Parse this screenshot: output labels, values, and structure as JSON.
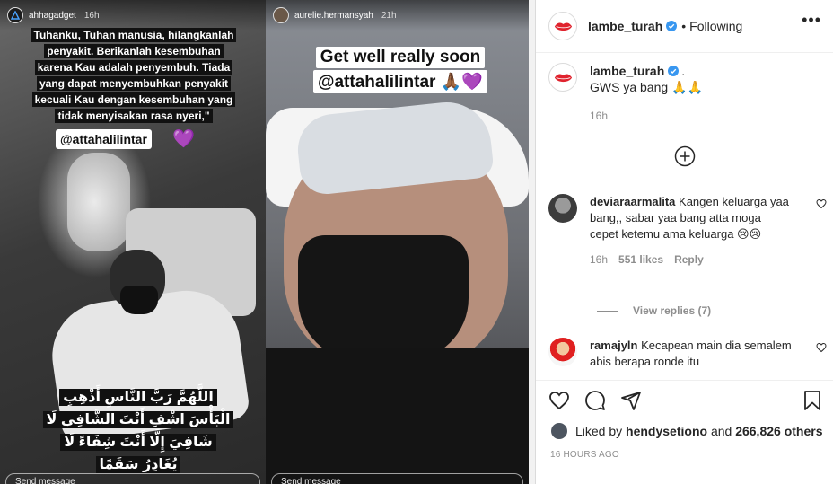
{
  "story_left": {
    "username": "ahhagadget",
    "time": "16h",
    "quote_lines": [
      "Tuhanku, Tuhan manusia, hilangkanlah",
      "penyakit. Berikanlah kesembuhan",
      "karena Kau adalah penyembuh. Tiada",
      "yang dapat menyembuhkan penyakit",
      "kecuali Kau dengan kesembuhan yang",
      "tidak menyisakan rasa nyeri,\""
    ],
    "mention": "@attahalilintar",
    "heart_emoji": "💜",
    "arabic_lines": [
      "اللَّهُمَّ رَبَّ النَّاسِ أَذْهِبِ",
      "الْبَأْسَ اشْفِ أَنْتَ الشَّافِي لَا",
      "شَافِيَ إِلَّا أَنْتَ شِفَاءً لَا",
      "يُغَادِرُ سَقَمًا"
    ],
    "footer": "Send message"
  },
  "story_right": {
    "username": "aurelie.hermansyah",
    "time": "21h",
    "caption_line1": "Get well really soon",
    "caption_line2": "@attahalilintar 🙏🏾💜",
    "footer": "Send message"
  },
  "header": {
    "username": "lambe_turah",
    "separator": "•",
    "follow_status": "Following",
    "more": "•••"
  },
  "caption": {
    "username": "lambe_turah",
    "suffix": ".",
    "text": "GWS ya bang 🙏🙏",
    "time": "16h"
  },
  "comments": [
    {
      "username": "deviaraarmalita",
      "text": "Kangen keluarga yaa bang,, sabar yaa bang atta moga cepet ketemu ama keluarga 😢😢",
      "time": "16h",
      "likes": "551 likes",
      "reply": "Reply"
    },
    {
      "username": "ramajyln",
      "text": "Kecapean main dia semalem abis berapa ronde itu"
    }
  ],
  "view_replies": "View replies (7)",
  "likes": {
    "prefix": "Liked by ",
    "user": "hendysetiono",
    "middle": " and ",
    "count": "266,826 others"
  },
  "posted": "16 HOURS AGO",
  "colors": {
    "verified": "#3897f0",
    "lips": "#e0232e",
    "avatar_ring": "#dbdbdb",
    "purple_heart": "#9b4ddc"
  },
  "icons": {
    "header_avatar": "lips-logo",
    "like": "heart-outline-icon",
    "comment": "speech-bubble-icon",
    "share": "paper-plane-icon",
    "save": "bookmark-icon",
    "load_more": "plus-circle-icon"
  }
}
